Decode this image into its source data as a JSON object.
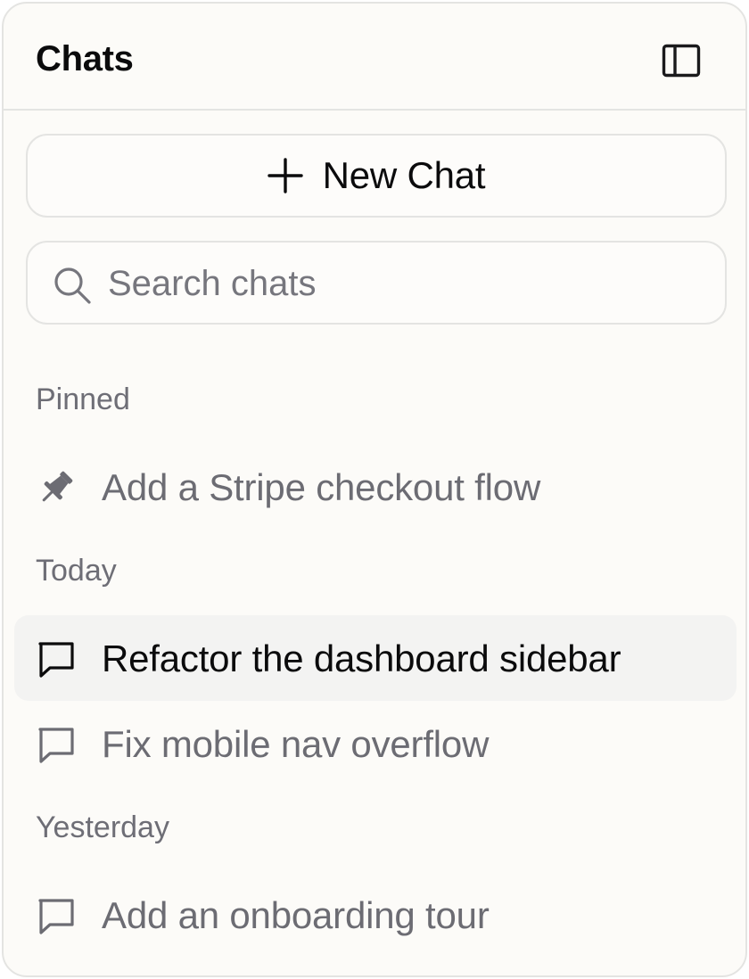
{
  "header": {
    "title": "Chats",
    "toggle_icon": "sidebar-toggle-icon"
  },
  "new_chat": {
    "label": "New Chat",
    "icon": "plus-icon"
  },
  "search": {
    "placeholder": "Search chats",
    "value": "",
    "icon": "search-icon"
  },
  "sections": [
    {
      "label": "Pinned",
      "items": [
        {
          "label": "Add a Stripe checkout flow",
          "icon": "pin-icon",
          "active": false
        }
      ]
    },
    {
      "label": "Today",
      "items": [
        {
          "label": "Refactor the dashboard sidebar",
          "icon": "chat-bubble-icon",
          "active": true
        },
        {
          "label": "Fix mobile nav overflow",
          "icon": "chat-bubble-icon",
          "active": false
        }
      ]
    },
    {
      "label": "Yesterday",
      "items": [
        {
          "label": "Add an onboarding tour",
          "icon": "chat-bubble-icon",
          "active": false
        }
      ]
    }
  ],
  "colors": {
    "panel_background": "#fcfbf8",
    "border": "#e4e4e2",
    "active_item_background": "#f3f3f2",
    "primary_text": "#0b0b0c",
    "muted_text": "#6c6c73"
  }
}
